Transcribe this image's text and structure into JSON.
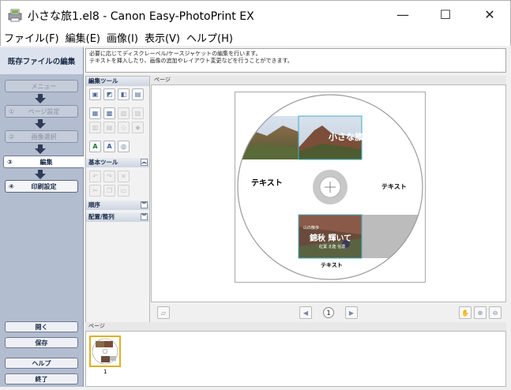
{
  "window": {
    "title": "小さな旅1.el8 - Canon Easy-PhotoPrint EX",
    "minimize": "—",
    "maximize": "☐",
    "close": "✕"
  },
  "menu": [
    "ファイル(F)",
    "編集(E)",
    "画像(I)",
    "表示(V)",
    "ヘルプ(H)"
  ],
  "sidebar": {
    "header": "既存ファイルの編集",
    "steps": [
      {
        "num": "",
        "label": "メニュー",
        "state": "disabled"
      },
      {
        "num": "①",
        "label": "ページ設定",
        "state": "disabled"
      },
      {
        "num": "②",
        "label": "画像選択",
        "state": "disabled"
      },
      {
        "num": "③",
        "label": "編集",
        "state": "active"
      },
      {
        "num": "④",
        "label": "印刷設定",
        "state": "enabled"
      }
    ],
    "buttons": {
      "open": "開く",
      "save": "保存",
      "help": "ヘルプ",
      "exit": "終了"
    }
  },
  "message": {
    "line1": "必要に応じてディスクレーベル/ケースジャケットの編集を行います。",
    "line2": "テキストを挿入したり、画像の追加やレイアウト変更などを行うことができます。"
  },
  "tools": {
    "edit_tools": "編集ツール",
    "basic_tools": "基本ツール",
    "order": "順序",
    "align": "配置/整列"
  },
  "page_area": {
    "label": "ページ",
    "disc": {
      "text_left": "テキスト",
      "text_right": "テキスト",
      "text_bottom": "テキスト",
      "photo_title": "小さな旅",
      "photo_caption_small": "山の散歩",
      "photo_caption_big": "錦秋 輝いて",
      "photo_caption_sub": "紅葉 北陸 信濃"
    },
    "page_number": "1"
  },
  "thumbnails": {
    "label": "ページ",
    "items": [
      {
        "num": "1"
      }
    ]
  },
  "colors": {
    "sidebar_bg": "#b3bdd0",
    "accent_border": "#e0b020"
  }
}
